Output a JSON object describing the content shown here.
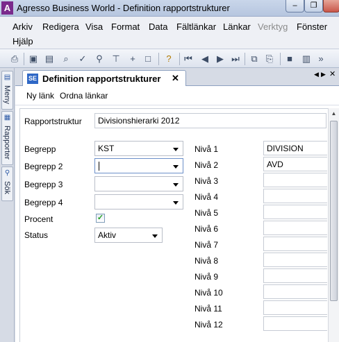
{
  "window": {
    "title": "Agresso Business World - Definition rapportstrukturer",
    "app_icon_letter": "A",
    "minimize_glyph": "–",
    "restore_glyph": "❐"
  },
  "menubar": {
    "row1": [
      "Arkiv",
      "Redigera",
      "Visa",
      "Format",
      "Data",
      "Fältlänkar",
      "Länkar",
      "Verktyg",
      "Fönster"
    ],
    "row2": [
      "Hjälp"
    ]
  },
  "toolbar": {
    "icons": [
      "print-icon",
      "save-icon",
      "open-icon",
      "find-icon",
      "check-icon",
      "search-icon",
      "filter-icon",
      "add-row-icon",
      "frame-icon",
      "help-icon",
      "first-icon",
      "prev-icon",
      "next-icon",
      "last-icon",
      "copy-icon",
      "paste-icon",
      "table-icon",
      "chart-icon",
      "more-icon"
    ]
  },
  "siderail": {
    "tabs": [
      {
        "label": "Meny",
        "icon": "menu-icon"
      },
      {
        "label": "Rapporter",
        "icon": "reports-icon"
      },
      {
        "label": "Sök",
        "icon": "search-icon"
      }
    ]
  },
  "doctab": {
    "icon_text": "SE",
    "title": "Definition rapportstrukturer",
    "close_glyph": "✕"
  },
  "linkbar": {
    "links": [
      "Ny länk",
      "Ordna länkar"
    ]
  },
  "form": {
    "rapportstruktur_label": "Rapportstruktur",
    "rapportstruktur_value": "Divisionshierarki 2012",
    "begrepp": [
      {
        "label": "Begrepp",
        "value": "KST"
      },
      {
        "label": "Begrepp 2",
        "value": ""
      },
      {
        "label": "Begrepp 3",
        "value": ""
      },
      {
        "label": "Begrepp 4",
        "value": ""
      }
    ],
    "procent_label": "Procent",
    "procent_checked": true,
    "status_label": "Status",
    "status_value": "Aktiv",
    "nivaer": [
      {
        "label": "Nivå 1",
        "value": "DIVISION"
      },
      {
        "label": "Nivå 2",
        "value": "AVD"
      },
      {
        "label": "Nivå 3",
        "value": ""
      },
      {
        "label": "Nivå 4",
        "value": ""
      },
      {
        "label": "Nivå 5",
        "value": ""
      },
      {
        "label": "Nivå 6",
        "value": ""
      },
      {
        "label": "Nivå 7",
        "value": ""
      },
      {
        "label": "Nivå 8",
        "value": ""
      },
      {
        "label": "Nivå 9",
        "value": ""
      },
      {
        "label": "Nivå 10",
        "value": ""
      },
      {
        "label": "Nivå 11",
        "value": ""
      },
      {
        "label": "Nivå 12",
        "value": ""
      }
    ]
  },
  "colors": {
    "app_icon": "#7a2a8c",
    "doc_icon": "#2f68c6",
    "checkmark": "#21a121"
  }
}
